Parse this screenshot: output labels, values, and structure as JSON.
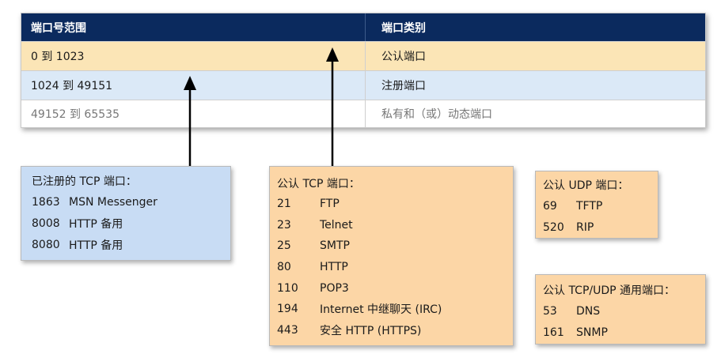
{
  "table": {
    "headers": [
      "端口号范围",
      "端口类别"
    ],
    "rows": [
      {
        "range": "0 到 1023",
        "category": "公认端口"
      },
      {
        "range": "1024 到 49151",
        "category": "注册端口"
      },
      {
        "range": "49152 到 65535",
        "category": "私有和（或）动态端口"
      }
    ]
  },
  "registered_tcp": {
    "title": "已注册的 TCP 端口：",
    "items": [
      {
        "port": "1863",
        "service": "MSN Messenger"
      },
      {
        "port": "8008",
        "service": "HTTP 备用"
      },
      {
        "port": "8080",
        "service": "HTTP 备用"
      }
    ]
  },
  "well_known_tcp": {
    "title": "公认 TCP 端口：",
    "items": [
      {
        "port": "21",
        "service": "FTP"
      },
      {
        "port": "23",
        "service": "Telnet"
      },
      {
        "port": "25",
        "service": "SMTP"
      },
      {
        "port": "80",
        "service": "HTTP"
      },
      {
        "port": "110",
        "service": "POP3"
      },
      {
        "port": "194",
        "service": "Internet 中继聊天 (IRC)"
      },
      {
        "port": "443",
        "service": "安全 HTTP (HTTPS)"
      }
    ]
  },
  "well_known_udp": {
    "title": "公认 UDP 端口：",
    "items": [
      {
        "port": "69",
        "service": "TFTP"
      },
      {
        "port": "520",
        "service": "RIP"
      }
    ]
  },
  "well_known_tcp_udp": {
    "title": "公认 TCP/UDP 通用端口：",
    "items": [
      {
        "port": "53",
        "service": "DNS"
      },
      {
        "port": "161",
        "service": "SNMP"
      }
    ]
  },
  "colors": {
    "header_bg": "#0b2a5e",
    "row_wellknown_bg": "#fbe5b6",
    "row_registered_bg": "#dbe9f7",
    "box_blue": "#c8dcf4",
    "box_orange": "#fcd6a6",
    "arrow": "#000000"
  }
}
